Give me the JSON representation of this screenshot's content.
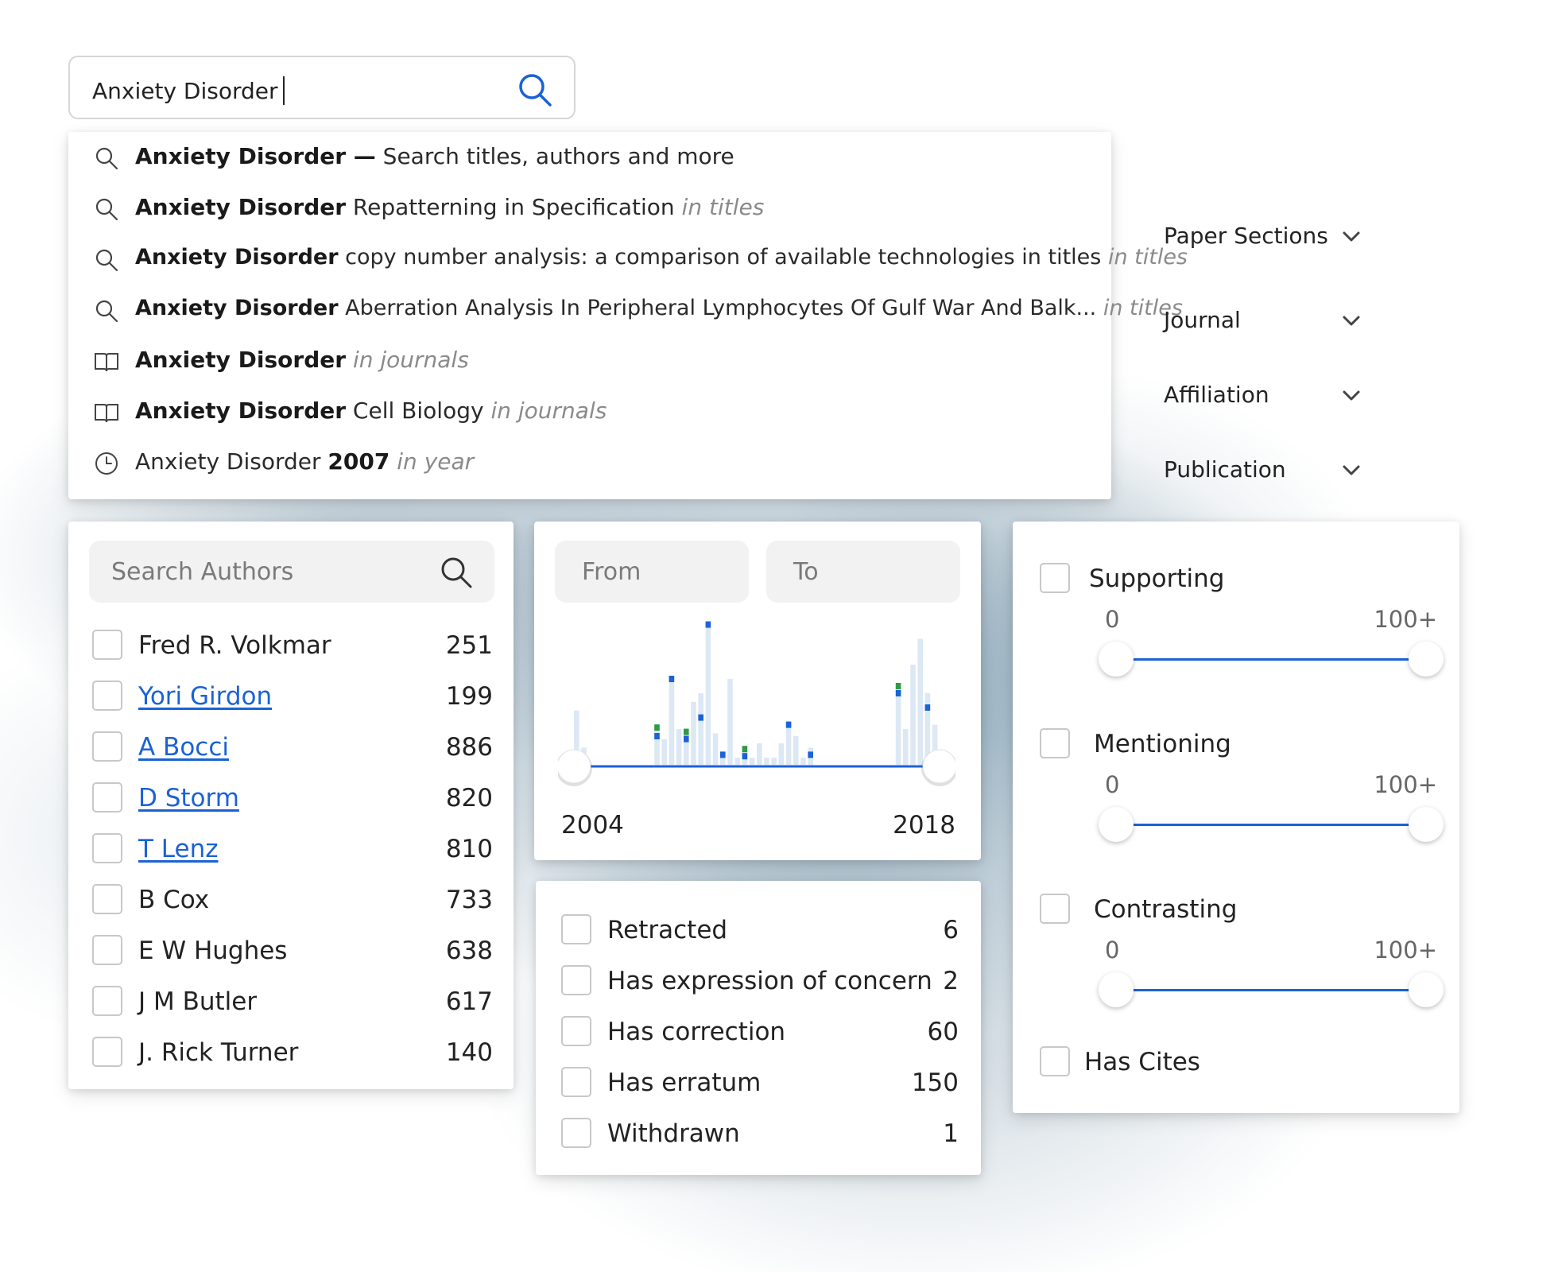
{
  "search": {
    "value": "Anxiety Disorder",
    "suggestions": [
      {
        "icon": "search-icon",
        "bold": "Anxiety Disorder —",
        "text": " Search titles, authors and more",
        "scope": ""
      },
      {
        "icon": "search-icon",
        "bold": "Anxiety Disorder",
        "text": " Repatterning in Specification ",
        "scope": "in titles"
      },
      {
        "icon": "search-icon",
        "bold": "Anxiety Disorder",
        "text": " copy number analysis: a comparison of available technologies in titles ",
        "scope": "in titles"
      },
      {
        "icon": "search-icon",
        "bold": "Anxiety Disorder",
        "text": " Aberration Analysis In Peripheral Lymphocytes Of Gulf War And Balk... ",
        "scope": "in titles"
      },
      {
        "icon": "book-icon",
        "bold": "Anxiety Disorder",
        "text": " ",
        "scope": "in journals"
      },
      {
        "icon": "book-icon",
        "bold": "Anxiety Disorder",
        "text": " Cell Biology ",
        "scope": "in journals"
      },
      {
        "icon": "clock-icon",
        "pre": "Anxiety Disorder ",
        "bold": "2007",
        "text": " ",
        "scope": "in year"
      }
    ]
  },
  "filters": {
    "paper_sections": "Paper Sections",
    "journal": "Journal",
    "affiliation": "Affiliation",
    "publication": "Publication"
  },
  "authors": {
    "placeholder": "Search Authors",
    "items": [
      {
        "name": "Fred R. Volkmar",
        "count": "251",
        "link": false
      },
      {
        "name": "Yori Girdon",
        "count": "199",
        "link": true
      },
      {
        "name": "A Bocci",
        "count": "886",
        "link": true
      },
      {
        "name": "D Storm",
        "count": "820",
        "link": true
      },
      {
        "name": "T Lenz",
        "count": "810",
        "link": true
      },
      {
        "name": "B Cox",
        "count": "733",
        "link": false
      },
      {
        "name": "E W Hughes",
        "count": "638",
        "link": false
      },
      {
        "name": "J M Butler",
        "count": "617",
        "link": false
      },
      {
        "name": "J. Rick Turner",
        "count": "140",
        "link": false
      }
    ]
  },
  "years": {
    "from_placeholder": "From",
    "to_placeholder": "To",
    "min_label": "2004",
    "max_label": "2018",
    "histogram": {
      "bars": [
        0.38,
        0.12,
        0,
        0,
        0,
        0,
        0,
        0,
        0,
        0,
        0,
        0.25,
        0.18,
        0.62,
        0.25,
        0.22,
        0.44,
        0.5,
        0.98,
        0.22,
        0.05,
        0.6,
        0.05,
        0.1,
        0.05,
        0.15,
        0.05,
        0.05,
        0.15,
        0.3,
        0.2,
        0.05,
        0.12,
        0,
        0,
        0,
        0,
        0,
        0,
        0,
        0,
        0,
        0,
        0,
        0.55,
        0.25,
        0.7,
        0.88,
        0.5,
        0.28
      ],
      "marks": [
        {
          "bar": 11,
          "level": 0.26,
          "color": "#2e9b45"
        },
        {
          "bar": 11,
          "level": 0.2,
          "color": "#1a62d6"
        },
        {
          "bar": 13,
          "level": 0.6,
          "color": "#1a62d6"
        },
        {
          "bar": 15,
          "level": 0.23,
          "color": "#2e9b45"
        },
        {
          "bar": 15,
          "level": 0.18,
          "color": "#1a62d6"
        },
        {
          "bar": 17,
          "level": 0.33,
          "color": "#1a62d6"
        },
        {
          "bar": 18,
          "level": 0.98,
          "color": "#1a62d6"
        },
        {
          "bar": 20,
          "level": 0.07,
          "color": "#1a62d6"
        },
        {
          "bar": 23,
          "level": 0.11,
          "color": "#2e9b45"
        },
        {
          "bar": 23,
          "level": 0.06,
          "color": "#1a62d6"
        },
        {
          "bar": 29,
          "level": 0.28,
          "color": "#1a62d6"
        },
        {
          "bar": 32,
          "level": 0.07,
          "color": "#1a62d6"
        },
        {
          "bar": 44,
          "level": 0.55,
          "color": "#2e9b45"
        },
        {
          "bar": 44,
          "level": 0.5,
          "color": "#1a62d6"
        },
        {
          "bar": 48,
          "level": 0.4,
          "color": "#1a62d6"
        }
      ]
    }
  },
  "status": {
    "items": [
      {
        "name": "Retracted",
        "count": "6"
      },
      {
        "name": "Has expression of concern",
        "count": "2"
      },
      {
        "name": "Has correction",
        "count": "60"
      },
      {
        "name": "Has erratum",
        "count": "150"
      },
      {
        "name": "Withdrawn",
        "count": "1"
      }
    ]
  },
  "citations": {
    "groups": [
      {
        "name": "Supporting",
        "min": "0",
        "max": "100+"
      },
      {
        "name": "Mentioning",
        "min": "0",
        "max": "100+"
      },
      {
        "name": "Contrasting",
        "min": "0",
        "max": "100+"
      }
    ],
    "has_cites": "Has Cites"
  },
  "colors": {
    "accent": "#1a62d6",
    "green": "#2e9b45",
    "histogram_bar": "#dde8f5"
  }
}
